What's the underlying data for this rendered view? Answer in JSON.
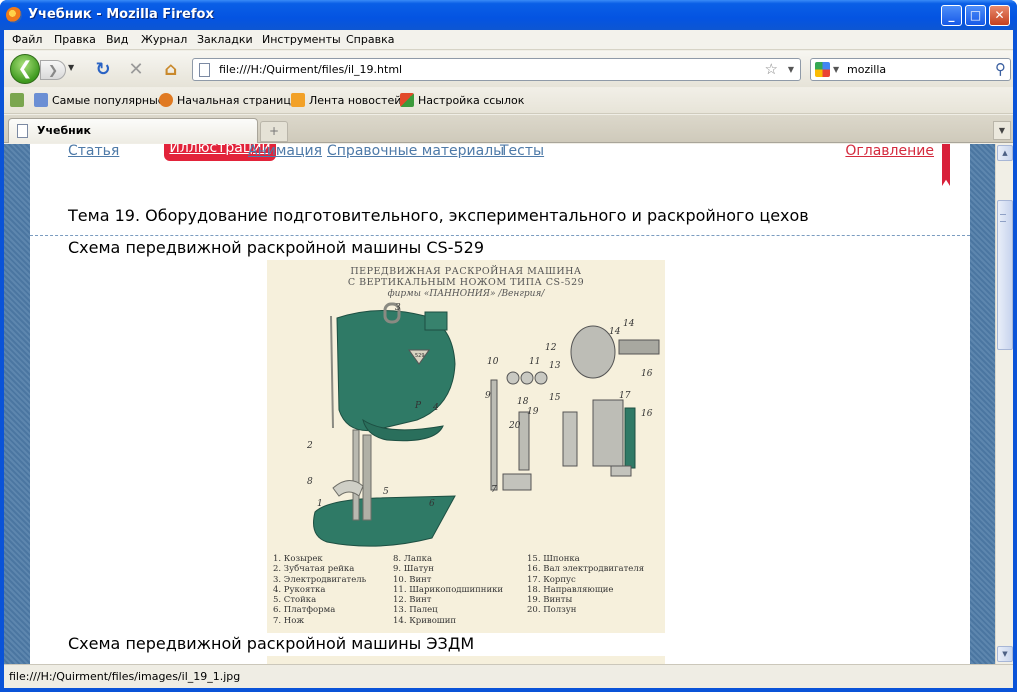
{
  "window": {
    "title": "Учебник - Mozilla Firefox"
  },
  "menu": [
    "Файл",
    "Правка",
    "Вид",
    "Журнал",
    "Закладки",
    "Инструменты",
    "Справка"
  ],
  "nav": {
    "url": "file:///H:/Quirment/files/il_19.html",
    "search_value": "mozilla"
  },
  "bookmarks": [
    "Самые популярные",
    "Начальная страница",
    "Лента новостей",
    "Настройка ссылок"
  ],
  "tab": {
    "label": "Учебник"
  },
  "page": {
    "nav_links": [
      "Статья",
      "Иллюстрации",
      "Анимация",
      "Справочные материалы",
      "Тесты"
    ],
    "toc": "Оглавление",
    "topic": "Тема 19. Оборудование подготовительного, экспериментального и раскройного цехов",
    "heading1": "Схема передвижной раскройной машины CS-529",
    "heading2": "Схема передвижной раскройной машины ЭЗДМ",
    "figure": {
      "title_lines": [
        "ПЕРЕДВИЖНАЯ РАСКРОЙНАЯ МАШИНА",
        "С ВЕРТИКАЛЬНЫМ НОЖОМ ТИПА CS-529",
        "фирмы «ПАННОНИЯ» /Венгрия/"
      ],
      "badge": "529",
      "labels": [
        "1",
        "2",
        "3",
        "4",
        "5",
        "6",
        "7",
        "8",
        "9",
        "10",
        "11",
        "12",
        "13",
        "14",
        "14",
        "15",
        "16",
        "16",
        "17",
        "18",
        "19",
        "20",
        "Р"
      ],
      "legend_col1": [
        "1. Козырек",
        "2. Зубчатая рейка",
        "3. Электродвигатель",
        "4. Рукоятка",
        "5. Стойка",
        "6. Платформа",
        "7. Нож"
      ],
      "legend_col2": [
        "8. Лапка",
        "9. Шатун",
        "10. Винт",
        "11. Шарикоподшипники",
        "12. Винт",
        "13. Палец",
        "14. Кривошип"
      ],
      "legend_col3": [
        "15. Шпонка",
        "16. Вал электродвигателя",
        "17. Корпус",
        "18. Направляющие",
        "19. Винты",
        "20. Ползун"
      ]
    }
  },
  "status": "file:///H:/Quirment/files/images/il_19_1.jpg",
  "colors": {
    "titlebar": "#0454e2",
    "active_nav": "#e2233a",
    "link": "#4e7aa8",
    "toc": "#d42a3d",
    "machine": "#2f7a66"
  }
}
